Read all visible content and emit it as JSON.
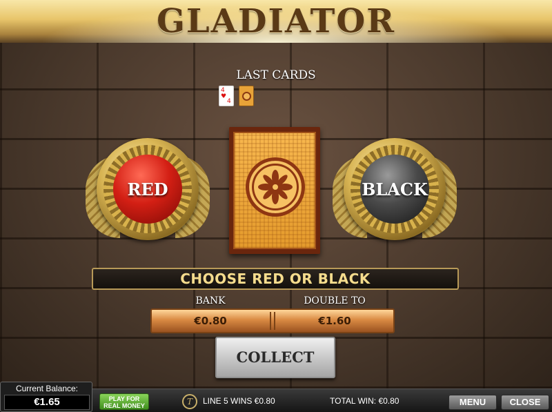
{
  "title": "GLADIATOR",
  "last_cards": {
    "label": "LAST CARDS",
    "cards": [
      {
        "kind": "face",
        "rank": "4",
        "suit": "hearts",
        "suit_symbol": "♥"
      },
      {
        "kind": "back"
      }
    ]
  },
  "choices": {
    "red_label": "RED",
    "black_label": "BLACK"
  },
  "message": "CHOOSE RED OR BLACK",
  "bank": {
    "label": "BANK",
    "value": "€0.80"
  },
  "double_to": {
    "label": "DOUBLE TO",
    "value": "€1.60"
  },
  "collect_label": "COLLECT",
  "footer": {
    "balance_label": "Current Balance:",
    "balance_value": "€1.65",
    "real_money_label": "PLAY FOR REAL MONEY",
    "logo_letter": "T",
    "line_win": "LINE 5 WINS €0.80",
    "total_win": "TOTAL WIN: €0.80",
    "menu_label": "MENU",
    "close_label": "CLOSE"
  },
  "colors": {
    "red_orb": "#d31f14",
    "black_orb": "#4a4a4a",
    "message_text": "#f5dc8d",
    "play_real_money": "#3f8e1d"
  },
  "icons": {
    "card_back": "flower-medallion-icon",
    "logo": "t-logo-icon"
  }
}
